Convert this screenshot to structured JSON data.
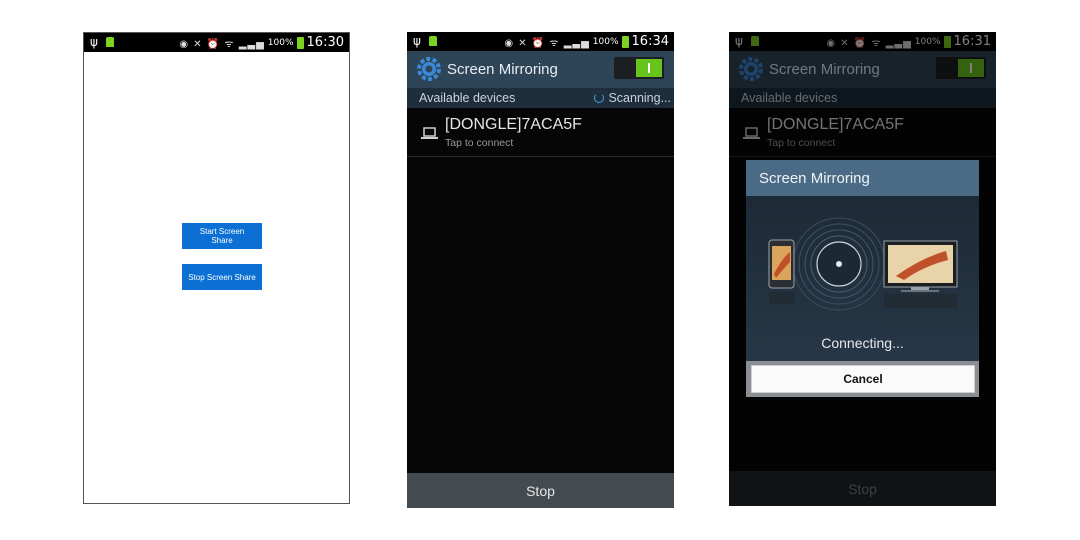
{
  "phone1": {
    "status": {
      "time": "16:30",
      "battery": "100%"
    },
    "buttons": {
      "start": "Start Screen Share",
      "stop": "Stop Screen Share"
    }
  },
  "phone2": {
    "status": {
      "time": "16:34",
      "battery": "100%"
    },
    "title": "Screen Mirroring",
    "available_label": "Available devices",
    "scanning_label": "Scanning...",
    "device": {
      "name": "[DONGLE]7ACA5F",
      "subtitle": "Tap to connect"
    },
    "stop_label": "Stop"
  },
  "phone3": {
    "status": {
      "time": "16:31",
      "battery": "100%"
    },
    "title": "Screen Mirroring",
    "available_label": "Available devices",
    "device": {
      "name": "[DONGLE]7ACA5F",
      "subtitle": "Tap to connect"
    },
    "stop_label": "Stop",
    "dialog": {
      "title": "Screen Mirroring",
      "message": "Connecting...",
      "cancel_label": "Cancel"
    }
  },
  "colors": {
    "accent_blue": "#0b6fd3",
    "toggle_on": "#68c41c",
    "action_bar": "#2e4457",
    "dialog_header": "#4b6a86"
  },
  "icons": [
    "usb-icon",
    "android-icon",
    "eye-icon",
    "mute-icon",
    "alarm-icon",
    "wifi-icon",
    "signal-icon",
    "battery-icon",
    "gear-icon",
    "laptop-icon",
    "phone-icon",
    "tv-icon"
  ]
}
